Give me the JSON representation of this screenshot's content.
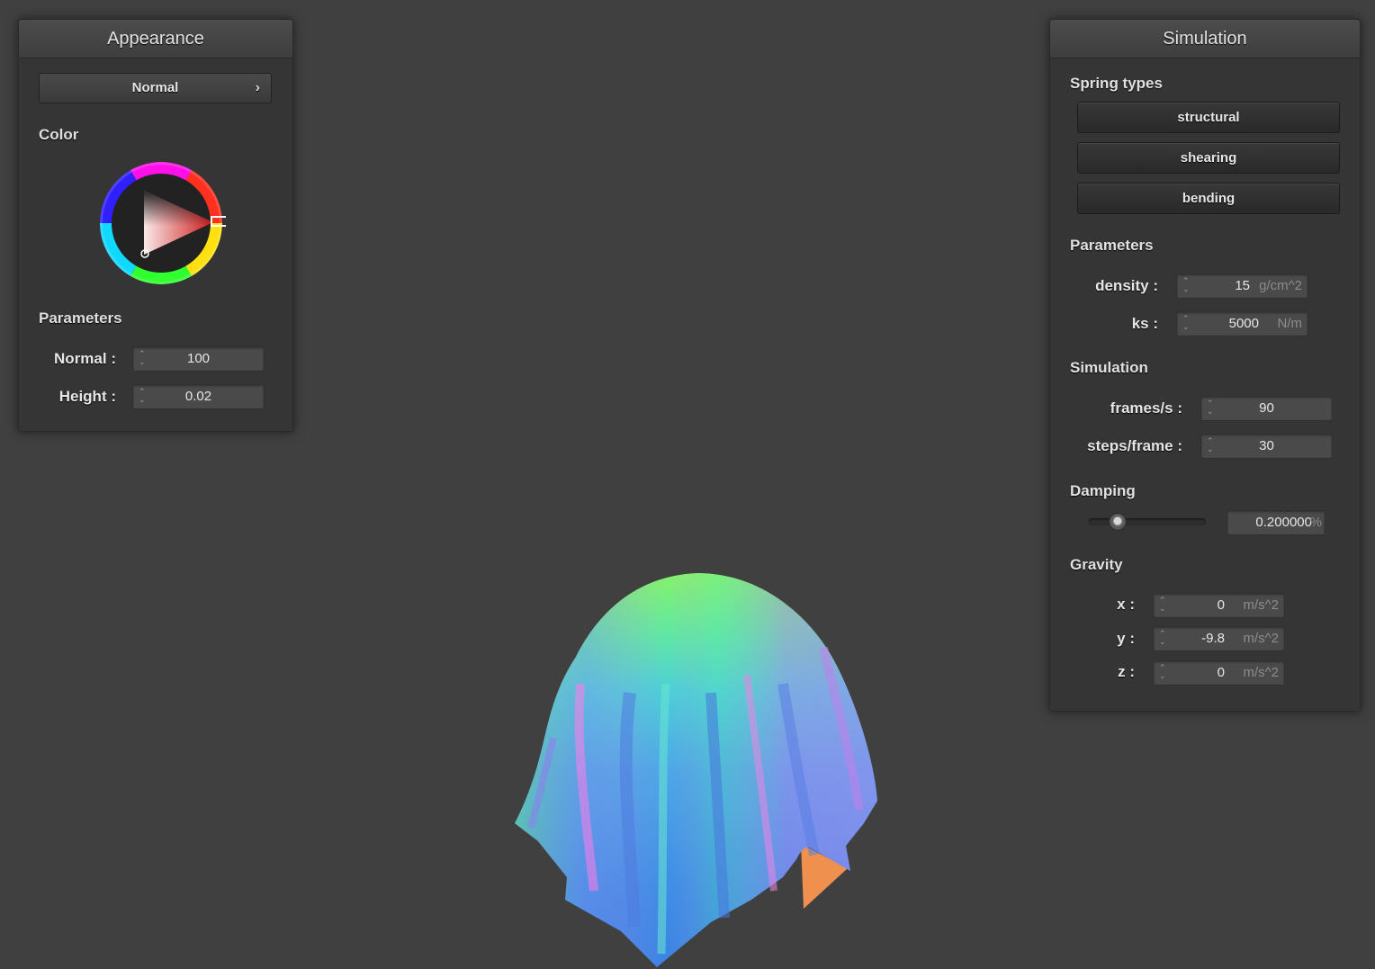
{
  "appearance": {
    "title": "Appearance",
    "shader_popup": {
      "label": "Normal",
      "chevron": "›"
    },
    "color_title": "Color",
    "color_value": "#cc1a1a",
    "parameters_title": "Parameters",
    "normal": {
      "label": "Normal :",
      "value": "100"
    },
    "height": {
      "label": "Height :",
      "value": "0.02"
    }
  },
  "simulation": {
    "title": "Simulation",
    "spring_types_title": "Spring types",
    "springs": [
      {
        "label": "structural"
      },
      {
        "label": "shearing"
      },
      {
        "label": "bending"
      }
    ],
    "parameters_title": "Parameters",
    "density": {
      "label": "density :",
      "value": "15",
      "unit": "g/cm^2"
    },
    "ks": {
      "label": "ks :",
      "value": "5000",
      "unit": "N/m"
    },
    "simulation_title": "Simulation",
    "fps": {
      "label": "frames/s :",
      "value": "90"
    },
    "steps": {
      "label": "steps/frame :",
      "value": "30"
    },
    "damping_title": "Damping",
    "damping": {
      "value": "0.200000",
      "unit": "%",
      "slider_fraction": 0.2
    },
    "gravity_title": "Gravity",
    "gravity": [
      {
        "label": "x :",
        "value": "0",
        "unit": "m/s^2"
      },
      {
        "label": "y :",
        "value": "-9.8",
        "unit": "m/s^2"
      },
      {
        "label": "z :",
        "value": "0",
        "unit": "m/s^2"
      }
    ]
  },
  "colors": {
    "background": "#404040",
    "panel": "#353535",
    "field": "#4a4a4a"
  }
}
